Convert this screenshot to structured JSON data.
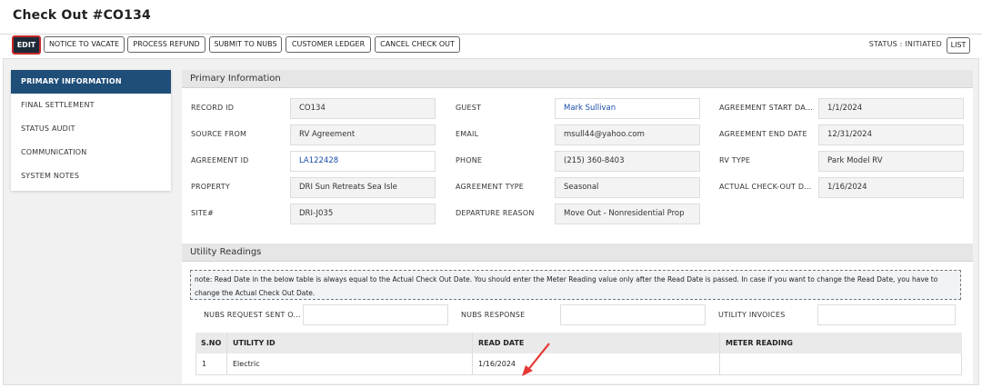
{
  "page": {
    "title": "Check Out #CO134"
  },
  "toolbar": {
    "edit": "EDIT",
    "notice_to_vacate": "NOTICE TO VACATE",
    "process_refund": "PROCESS REFUND",
    "submit_to_nubs": "SUBMIT TO NUBS",
    "customer_ledger": "CUSTOMER LEDGER",
    "cancel_check_out": "CANCEL CHECK OUT",
    "status": "STATUS : INITIATED",
    "list": "LIST"
  },
  "sidebar": {
    "items": [
      {
        "label": "PRIMARY INFORMATION",
        "active": true
      },
      {
        "label": "FINAL SETTLEMENT",
        "active": false
      },
      {
        "label": "STATUS AUDIT",
        "active": false
      },
      {
        "label": "COMMUNICATION",
        "active": false
      },
      {
        "label": "SYSTEM NOTES",
        "active": false
      }
    ]
  },
  "primary": {
    "header": "Primary Information",
    "record_id": {
      "label": "RECORD ID",
      "value": "CO134"
    },
    "source_from": {
      "label": "SOURCE FROM",
      "value": "RV Agreement"
    },
    "agreement_id": {
      "label": "AGREEMENT ID",
      "value": "LA122428"
    },
    "property": {
      "label": "PROPERTY",
      "value": "DRI Sun Retreats Sea Isle"
    },
    "site": {
      "label": "SITE#",
      "value": "DRI-J035"
    },
    "guest": {
      "label": "GUEST",
      "value": "Mark Sullivan"
    },
    "email": {
      "label": "EMAIL",
      "value": "msull44@yahoo.com"
    },
    "phone": {
      "label": "PHONE",
      "value": "(215) 360-8403"
    },
    "agreement_type": {
      "label": "AGREEMENT TYPE",
      "value": "Seasonal"
    },
    "departure_reason": {
      "label": "DEPARTURE REASON",
      "value": "Move Out - Nonresidential Prop"
    },
    "agreement_start": {
      "label": "AGREEMENT START DA...",
      "value": "1/1/2024"
    },
    "agreement_end": {
      "label": "AGREEMENT END DATE",
      "value": "12/31/2024"
    },
    "rv_type": {
      "label": "RV TYPE",
      "value": "Park Model RV"
    },
    "actual_checkout": {
      "label": "ACTUAL CHECK-OUT D...",
      "value": "1/16/2024"
    }
  },
  "utility": {
    "header": "Utility Readings",
    "note": "note: Read Date in the below table is always equal to the Actual Check Out Date. You should enter the Meter Reading value only after the Read Date is passed. In case if you want to change the Read Date, you have to change the Actual Check Out Date.",
    "nubs_request_label": "NUBS REQUEST SENT O...",
    "nubs_request_value": "",
    "nubs_response_label": "NUBS RESPONSE",
    "nubs_response_value": "",
    "utility_invoices_label": "UTILITY INVOICES",
    "utility_invoices_value": "",
    "columns": [
      "S.NO",
      "UTILITY ID",
      "READ DATE",
      "METER READING"
    ],
    "rows": [
      {
        "sno": "1",
        "utility_id": "Electric",
        "read_date": "1/16/2024",
        "meter_reading": ""
      }
    ]
  },
  "colors": {
    "accent": "#1f4e79",
    "edit_bg": "#1e2a38",
    "edit_border": "#c62828",
    "link": "#1a4da8",
    "arrow": "#e53935"
  }
}
